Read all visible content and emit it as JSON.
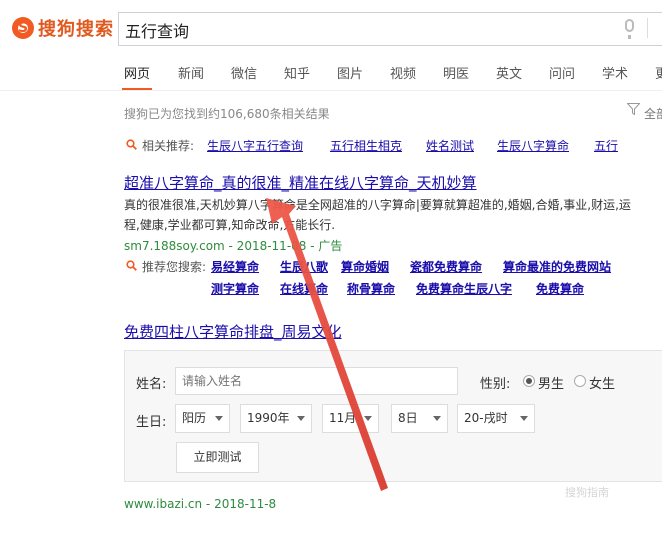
{
  "header": {
    "logo_text": "搜狗搜索",
    "search_value": "五行查询"
  },
  "tabs": [
    "网页",
    "新闻",
    "微信",
    "知乎",
    "图片",
    "视频",
    "明医",
    "英文",
    "问问",
    "学术",
    "更"
  ],
  "results_meta": {
    "count_text": "搜狗已为您找到约106,680条相关结果",
    "filter_label": "全部"
  },
  "related": {
    "label": "相关推荐:",
    "links": [
      "生辰八字五行查询",
      "五行相生相克",
      "姓名测试",
      "生辰八字算命",
      "五行"
    ]
  },
  "result1": {
    "title": "超准八字算命_真的很准_精准在线八字算命_天机妙算",
    "snippet_line1": "真的很准很准,天机妙算八字算命是全网超准的八字算命|要算就算超准的,婚姻,合婚,事业,财运,运",
    "snippet_line2": "程,健康,学业都可算,知命改命,方能长行.",
    "url": "sm7.188soy.com - 2018-11-08 - 广告",
    "recommend_label": "推荐您搜索:",
    "recommend_links": [
      "易经算命",
      "生辰八歌",
      "算命婚姻",
      "瓷都免费算命",
      "算命最准的免费网站",
      "测字算命",
      "在线算命",
      "称骨算命",
      "免费算命生辰八字",
      "免费算命"
    ]
  },
  "result2": {
    "title": "免费四柱八字算命排盘_周易文化",
    "form": {
      "name_label": "姓名:",
      "name_placeholder": "请输入姓名",
      "gender_label": "性别:",
      "male": "男生",
      "female": "女生",
      "birth_label": "生日:",
      "calendar": "阳历",
      "year": "1990年",
      "month": "11月",
      "day": "8日",
      "hour": "20-戌时",
      "submit": "立即测试"
    },
    "url": "www.ibazi.cn - 2018-11-8"
  },
  "watermark": "搜狗指南",
  "colors": {
    "brand": "#f15a22",
    "link": "#1a0dab",
    "url": "#2e8b3d",
    "annotation_arrow": "#e8453c"
  }
}
